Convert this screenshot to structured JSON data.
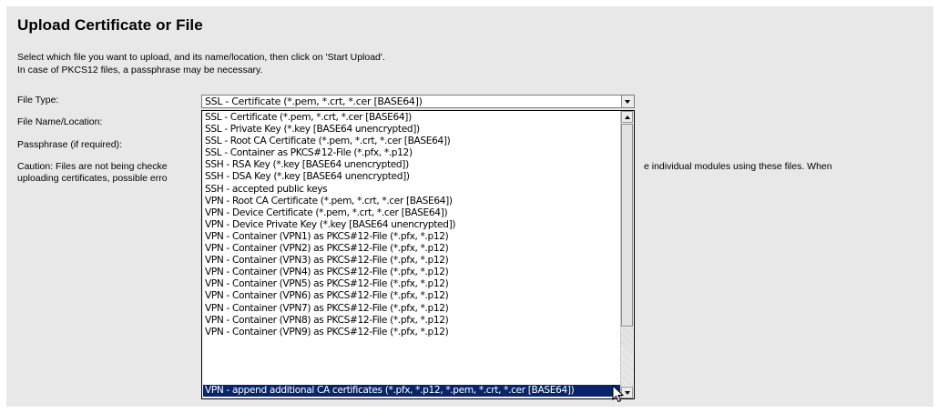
{
  "page": {
    "title": "Upload Certificate or File",
    "intro_line1": "Select which file you want to upload, and its name/location, then click on 'Start Upload'.",
    "intro_line2": "In case of PKCS12 files, a passphrase may be necessary."
  },
  "form": {
    "file_type_label": "File Type:",
    "file_name_label": "File Name/Location:",
    "passphrase_label": "Passphrase (if required):",
    "caution_left": "Caution: Files are not being checke",
    "caution_left2": "uploading certificates, possible erro",
    "caution_right": "e individual modules using these files. When"
  },
  "file_type_select": {
    "selected_value": "SSL - Certificate (*.pem, *.crt, *.cer [BASE64])",
    "highlighted_index": 22,
    "options": [
      "SSL - Certificate (*.pem, *.crt, *.cer [BASE64])",
      "SSL - Private Key (*.key [BASE64 unencrypted])",
      "SSL - Root CA Certificate (*.pem, *.crt, *.cer [BASE64])",
      "SSL - Container as PKCS#12-File (*.pfx, *.p12)",
      "SSH - RSA Key (*.key [BASE64 unencrypted])",
      "SSH - DSA Key (*.key [BASE64 unencrypted])",
      "SSH - accepted public keys",
      "VPN - Root CA Certificate (*.pem, *.crt, *.cer [BASE64])",
      "VPN - Device Certificate (*.pem, *.crt, *.cer [BASE64])",
      "VPN - Device Private Key (*.key [BASE64 unencrypted])",
      "VPN - Container (VPN1) as PKCS#12-File (*.pfx, *.p12)",
      "VPN - Container (VPN2) as PKCS#12-File (*.pfx, *.p12)",
      "VPN - Container (VPN3) as PKCS#12-File (*.pfx, *.p12)",
      "VPN - Container (VPN4) as PKCS#12-File (*.pfx, *.p12)",
      "VPN - Container (VPN5) as PKCS#12-File (*.pfx, *.p12)",
      "VPN - Container (VPN6) as PKCS#12-File (*.pfx, *.p12)",
      "VPN - Container (VPN7) as PKCS#12-File (*.pfx, *.p12)",
      "VPN - Container (VPN8) as PKCS#12-File (*.pfx, *.p12)",
      "VPN - Container (VPN9) as PKCS#12-File (*.pfx, *.p12)",
      "VPN - append additional CA certificates (*.pfx, *.p12, *.pem, *.crt, *.cer [BASE64])"
    ]
  },
  "colors": {
    "panel_bg": "#e8e8e8",
    "selection_bg": "#0a246a",
    "selection_fg": "#ffffff"
  },
  "icons": {
    "dropdown": "chevron-down-icon",
    "scroll_up": "scroll-up-arrow-icon",
    "scroll_down": "scroll-down-arrow-icon",
    "cursor": "mouse-pointer-icon"
  }
}
